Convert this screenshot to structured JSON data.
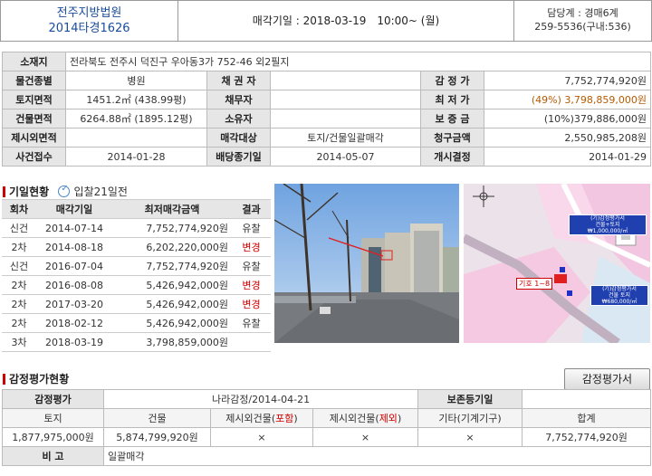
{
  "header": {
    "court": "전주지방법원",
    "case_no": "2014타경1626",
    "auction_date": "매각기일 : 2018-03-19　10:00~ (월)",
    "manager": "담당계 : 경매6계",
    "phone": "259-5536(구내:536)"
  },
  "info": {
    "location_label": "소재지",
    "location_value": "전라북도 전주시 덕진구 우아동3가 752-46 외2필지",
    "rows": [
      {
        "l1": "물건종별",
        "v1": "병원",
        "l2": "채 권 자",
        "v2": "",
        "l3": "감 정 가",
        "v3": "7,752,774,920원"
      },
      {
        "l1": "토지면적",
        "v1": "1451.2㎡ (438.99평)",
        "l2": "채무자",
        "v2": "",
        "l3": "최 저 가",
        "v3": "(49%) 3,798,859,000원"
      },
      {
        "l1": "건물면적",
        "v1": "6264.88㎡ (1895.12평)",
        "l2": "소유자",
        "v2": "",
        "l3": "보 증 금",
        "v3": "(10%)379,886,000원"
      },
      {
        "l1": "제시외면적",
        "v1": "",
        "l2": "매각대상",
        "v2": "토지/건물일괄매각",
        "l3": "청구금액",
        "v3": "2,550,985,208원"
      },
      {
        "l1": "사건접수",
        "v1": "2014-01-28",
        "l2": "배당종기일",
        "v2": "2014-05-07",
        "l3": "개시결정",
        "v3": "2014-01-29"
      }
    ]
  },
  "history": {
    "title": "기일현황",
    "badge": "입찰21일전",
    "headers": [
      "회차",
      "매각기일",
      "최저매각금액",
      "결과"
    ],
    "rows": [
      {
        "round": "신건",
        "date": "2014-07-14",
        "price": "7,752,774,920원",
        "result": "유찰",
        "color": "#333"
      },
      {
        "round": "2차",
        "date": "2014-08-18",
        "price": "6,202,220,000원",
        "result": "변경",
        "color": "#c00"
      },
      {
        "round": "신건",
        "date": "2016-07-04",
        "price": "7,752,774,920원",
        "result": "유찰",
        "color": "#333"
      },
      {
        "round": "2차",
        "date": "2016-08-08",
        "price": "5,426,942,000원",
        "result": "변경",
        "color": "#c00"
      },
      {
        "round": "2차",
        "date": "2017-03-20",
        "price": "5,426,942,000원",
        "result": "변경",
        "color": "#c00"
      },
      {
        "round": "2차",
        "date": "2018-02-12",
        "price": "5,426,942,000원",
        "result": "유찰",
        "color": "#333"
      },
      {
        "round": "3차",
        "date": "2018-03-19",
        "price": "3,798,859,000원",
        "result": "",
        "color": "#333"
      }
    ]
  },
  "map": {
    "marker": "기호 1~8",
    "label1": "(기)감정평가서\n건물+토지\n₩1,000,000/㎡",
    "label2": "(기)감정평가서\n건물 토지\n₩680,000/㎡"
  },
  "appraisal": {
    "title": "감정평가현황",
    "button": "감정평가서",
    "r1": {
      "l": "감정평가",
      "v": "나라감정/2014-04-21",
      "l2": "보존등기일",
      "v2": ""
    },
    "r2": [
      "토지",
      "건물",
      "제시외건물(",
      "포함",
      ")",
      "제시외건물(",
      "제외",
      ")",
      "기타(기계기구)",
      "합계"
    ],
    "r3": [
      "1,877,975,000원",
      "5,874,799,920원",
      "×",
      "×",
      "×",
      "7,752,774,920원"
    ],
    "r4": {
      "l": "비 고",
      "v": "일괄매각"
    }
  }
}
